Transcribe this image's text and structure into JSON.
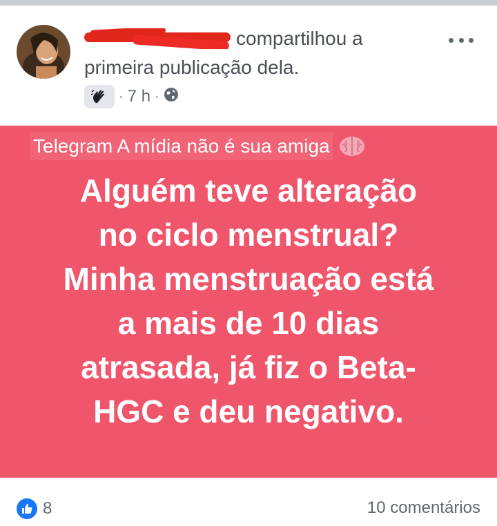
{
  "post": {
    "author_suffix": "compartilhou a",
    "action_line2": "primeira publicação dela.",
    "time": "7 h",
    "separator": "·",
    "more_icon": "more-dots-icon",
    "privacy_icon": "globe-icon"
  },
  "card": {
    "background": "#f0566b",
    "source": "Telegram A mídia não é sua amiga",
    "lines": [
      "Alguém teve alteração",
      "no ciclo menstrual?",
      "Minha menstruação está",
      "a mais de 10 dias",
      "atrasada, já fiz o Beta-",
      "HGC e deu negativo."
    ]
  },
  "footer": {
    "like_count": "8",
    "comments": "10 comentários"
  }
}
